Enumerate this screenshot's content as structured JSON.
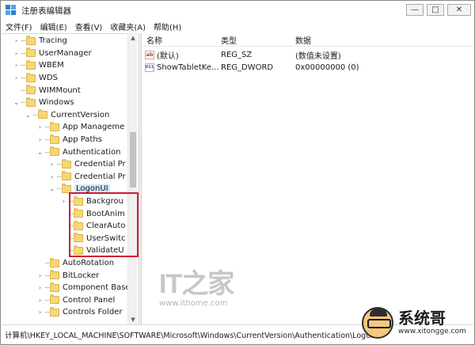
{
  "window": {
    "title": "注册表编辑器",
    "controls": {
      "minimize": "—",
      "maximize": "□",
      "close": "✕"
    }
  },
  "menu": [
    "文件(F)",
    "编辑(E)",
    "查看(V)",
    "收藏夹(A)",
    "帮助(H)"
  ],
  "tree": {
    "items": [
      {
        "label": "Tracing",
        "expander": "›",
        "level": 0
      },
      {
        "label": "UserManager",
        "expander": "›",
        "level": 0
      },
      {
        "label": "WBEM",
        "expander": "›",
        "level": 0
      },
      {
        "label": "WDS",
        "expander": "›",
        "level": 0
      },
      {
        "label": "WIMMount",
        "expander": "",
        "level": 0
      },
      {
        "label": "Windows",
        "expander": "⌄",
        "level": 0
      },
      {
        "label": "CurrentVersion",
        "expander": "⌄",
        "level": 1
      },
      {
        "label": "App Manageme",
        "expander": "›",
        "level": 2
      },
      {
        "label": "App Paths",
        "expander": "›",
        "level": 2
      },
      {
        "label": "Authentication",
        "expander": "⌄",
        "level": 2
      },
      {
        "label": "Credential Pr",
        "expander": "›",
        "level": 3
      },
      {
        "label": "Credential Pr",
        "expander": "›",
        "level": 3
      },
      {
        "label": "LogonUI",
        "expander": "⌄",
        "level": 3,
        "selected": true
      },
      {
        "label": "Backgrou",
        "expander": "›",
        "level": 4
      },
      {
        "label": "BootAnim",
        "expander": "",
        "level": 4
      },
      {
        "label": "ClearAuto",
        "expander": "",
        "level": 4
      },
      {
        "label": "UserSwitc",
        "expander": "",
        "level": 4
      },
      {
        "label": "ValidateU",
        "expander": "",
        "level": 4
      },
      {
        "label": "AutoRotation",
        "expander": "",
        "level": 2
      },
      {
        "label": "BitLocker",
        "expander": "›",
        "level": 2
      },
      {
        "label": "Component Base",
        "expander": "›",
        "level": 2
      },
      {
        "label": "Control Panel",
        "expander": "›",
        "level": 2
      },
      {
        "label": "Controls Folder",
        "expander": "›",
        "level": 2
      }
    ]
  },
  "list": {
    "columns": {
      "name": "名称",
      "type": "类型",
      "data": "数据"
    },
    "rows": [
      {
        "icon": "string-value-icon",
        "icon_text": "ab",
        "name": "(默认)",
        "type": "REG_SZ",
        "data": "(数值未设置)"
      },
      {
        "icon": "dword-value-icon",
        "icon_text": "011\n110",
        "name": "ShowTabletKe...",
        "type": "REG_DWORD",
        "data": "0x00000000 (0)"
      }
    ]
  },
  "status_bar": {
    "path": "计算机\\HKEY_LOCAL_MACHINE\\SOFTWARE\\Microsoft\\Windows\\CurrentVersion\\Authentication\\LogonUI"
  },
  "scrollbar": {
    "up": "▲",
    "down": "▼"
  },
  "watermarks": {
    "ithome_logo": "IT之家",
    "ithome_url": "www.ithome.com",
    "xitongge_name": "系统哥",
    "xitongge_url": "www.xitongge.com"
  },
  "colors": {
    "selection_highlight": "#cce8ff",
    "annotation_box": "#d01c2f",
    "folder": "#f7d774"
  }
}
